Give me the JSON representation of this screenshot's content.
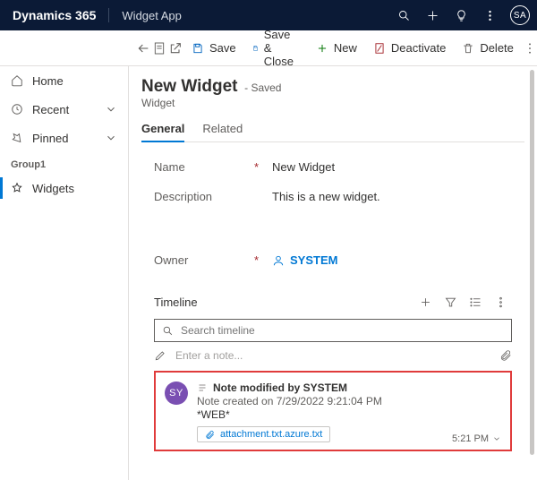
{
  "topbar": {
    "brand": "Dynamics 365",
    "app_name": "Widget App",
    "avatar": "SA"
  },
  "commands": {
    "save": "Save",
    "save_close": "Save & Close",
    "new": "New",
    "deactivate": "Deactivate",
    "delete": "Delete"
  },
  "sidebar": {
    "items": [
      {
        "label": "Home",
        "icon": "home"
      },
      {
        "label": "Recent",
        "icon": "clock",
        "chev": true
      },
      {
        "label": "Pinned",
        "icon": "pin",
        "chev": true
      }
    ],
    "group_label": "Group1",
    "group_items": [
      {
        "label": "Widgets",
        "icon": "gear"
      }
    ]
  },
  "header": {
    "title": "New Widget",
    "saved": "- Saved",
    "entity": "Widget"
  },
  "tabs": {
    "general": "General",
    "related": "Related"
  },
  "form": {
    "name_label": "Name",
    "name_value": "New Widget",
    "desc_label": "Description",
    "desc_value": "This is a new widget.",
    "owner_label": "Owner",
    "owner_value": "SYSTEM"
  },
  "timeline": {
    "label": "Timeline",
    "search_placeholder": "Search timeline",
    "enter_note": "Enter a note...",
    "note": {
      "avatar": "SY",
      "title": "Note modified by SYSTEM",
      "created": "Note created on 7/29/2022 9:21:04 PM",
      "web": "*WEB*",
      "attachment": "attachment.txt.azure.txt",
      "time": "5:21 PM"
    }
  }
}
